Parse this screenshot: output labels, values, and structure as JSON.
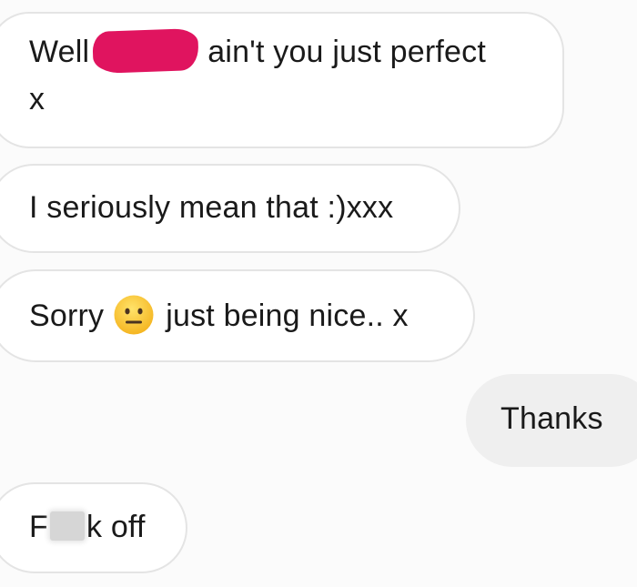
{
  "conversation": {
    "messages": [
      {
        "direction": "received",
        "before_redaction": "Well",
        "after_redaction": "ain't you just perfect",
        "second_line": "x"
      },
      {
        "direction": "received",
        "text": "I seriously mean that :)xxx"
      },
      {
        "direction": "received",
        "before_emoji": "Sorry",
        "emoji": "neutral-face-emoji",
        "after_emoji": "just being nice.. x"
      },
      {
        "direction": "sent",
        "text": "Thanks"
      },
      {
        "direction": "received",
        "before_censor": "F",
        "after_censor": "k off"
      }
    ]
  },
  "colors": {
    "background": "#fbfbfb",
    "received_bubble": "#ffffff",
    "received_border": "#e4e4e4",
    "sent_bubble": "#efefef",
    "text": "#1a1a1a",
    "redaction": "#e0145f"
  }
}
